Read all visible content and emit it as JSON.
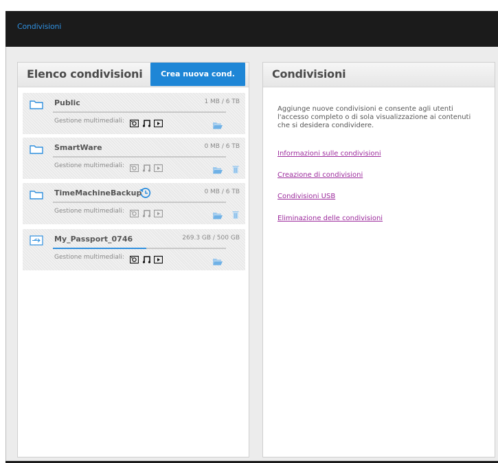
{
  "header": {
    "title": "Condivisioni"
  },
  "left_panel": {
    "title": "Elenco condivisioni",
    "create_button": "Crea nuova cond.",
    "media_label": "Gestione multimediali:",
    "shares": [
      {
        "name": "Public",
        "size": "1 MB / 6 TB",
        "usage_fraction": 0.0,
        "media_active": true,
        "icon": "folder-icon",
        "trash": false,
        "restore": false
      },
      {
        "name": "SmartWare",
        "size": "0 MB / 6 TB",
        "usage_fraction": 0.0,
        "media_active": false,
        "icon": "folder-icon",
        "trash": true,
        "restore": false
      },
      {
        "name": "TimeMachineBackup",
        "size": "0 MB / 6 TB",
        "usage_fraction": 0.0,
        "media_active": false,
        "icon": "folder-icon",
        "trash": true,
        "restore": true
      },
      {
        "name": "My_Passport_0746",
        "size": "269.3 GB / 500 GB",
        "usage_fraction": 0.54,
        "media_active": true,
        "icon": "usb-drive-icon",
        "trash": false,
        "restore": false
      }
    ]
  },
  "right_panel": {
    "title": "Condivisioni",
    "description": "Aggiunge nuove condivisioni e consente agli utenti l'accesso completo o di sola visualizzazione ai contenuti che si desidera condividere.",
    "links": [
      "Informazioni sulle condivisioni",
      "Creazione di condivisioni",
      "Condivisioni USB",
      "Eliminazione delle condivisioni"
    ]
  },
  "colors": {
    "accent": "#1e86d6",
    "link": "#9c2a9c",
    "topbar": "#1b1b1b",
    "title_blue": "#2f8fde"
  }
}
